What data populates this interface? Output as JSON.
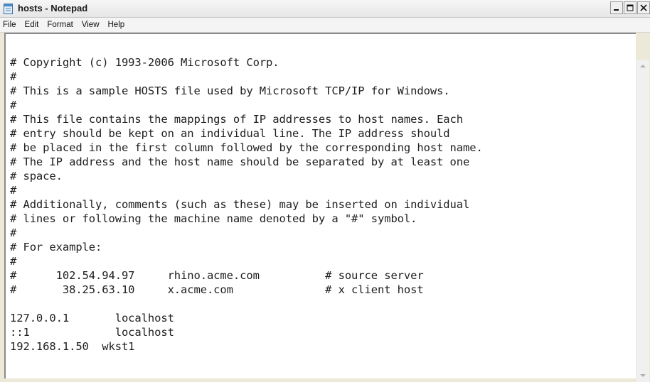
{
  "window": {
    "title": "hosts - Notepad",
    "icon": "notepad-icon"
  },
  "menu": [
    {
      "label": "File"
    },
    {
      "label": "Edit"
    },
    {
      "label": "Format"
    },
    {
      "label": "View"
    },
    {
      "label": "Help"
    }
  ],
  "editor": {
    "lines": [
      "# Copyright (c) 1993-2006 Microsoft Corp.",
      "#",
      "# This is a sample HOSTS file used by Microsoft TCP/IP for Windows.",
      "#",
      "# This file contains the mappings of IP addresses to host names. Each",
      "# entry should be kept on an individual line. The IP address should",
      "# be placed in the first column followed by the corresponding host name.",
      "# The IP address and the host name should be separated by at least one",
      "# space.",
      "#",
      "# Additionally, comments (such as these) may be inserted on individual",
      "# lines or following the machine name denoted by a \"#\" symbol.",
      "#",
      "# For example:",
      "#",
      "#      102.54.94.97     rhino.acme.com          # source server",
      "#       38.25.63.10     x.acme.com              # x client host",
      "",
      "127.0.0.1       localhost",
      "::1             localhost",
      "192.168.1.50  wkst1"
    ]
  }
}
